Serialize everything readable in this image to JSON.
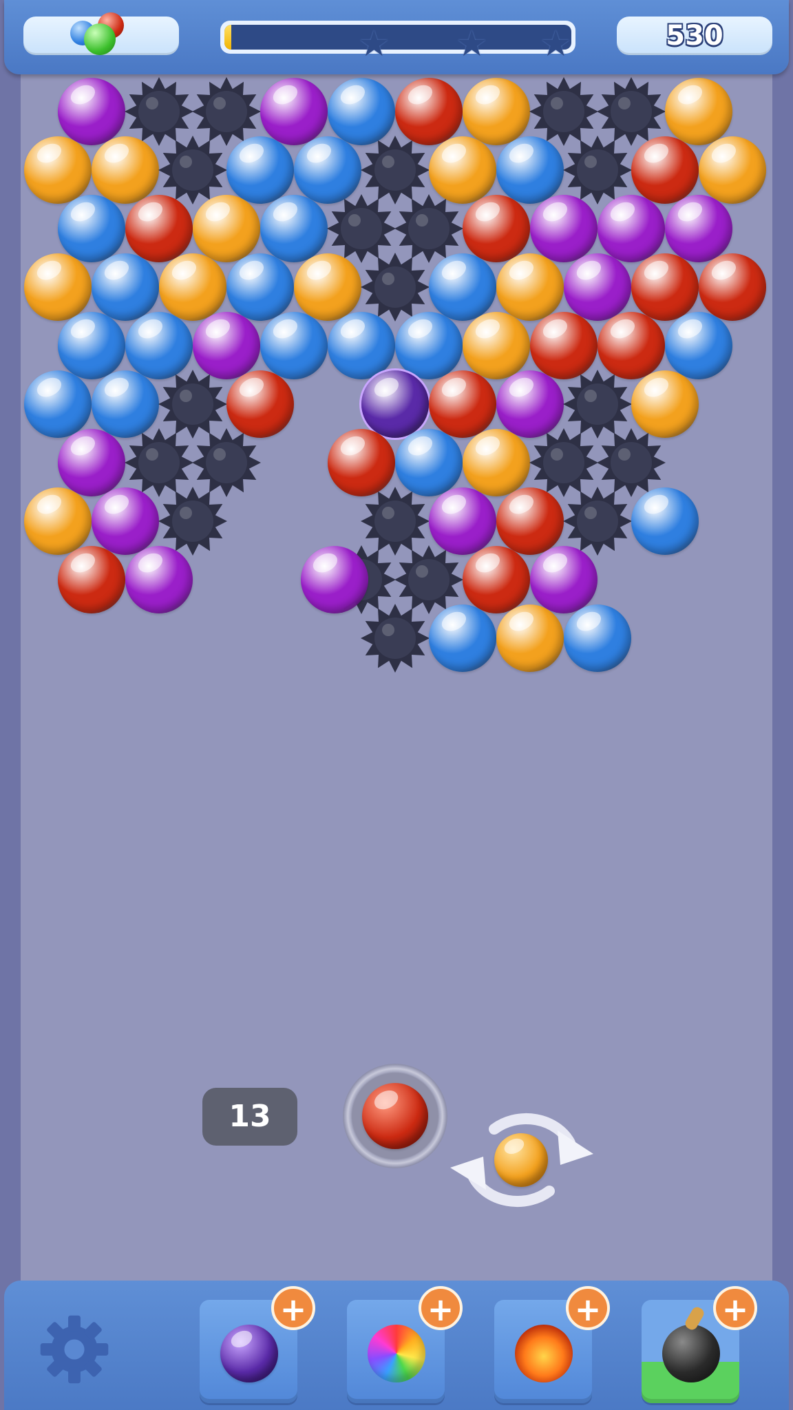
{
  "hud": {
    "score": "530",
    "progress": 0.02,
    "stars": [
      "star-1",
      "star-2",
      "star-3"
    ],
    "bubble_colors": [
      "blue",
      "red",
      "green"
    ]
  },
  "shooter": {
    "moves_left": "13",
    "current_bubble": "red",
    "next_bubble": "orange"
  },
  "boosters": [
    {
      "name": "lightning-bubble",
      "plus": "+"
    },
    {
      "name": "rainbow-bubble",
      "plus": "+"
    },
    {
      "name": "fire-bubble",
      "plus": "+"
    },
    {
      "name": "bomb",
      "plus": "+"
    }
  ],
  "colors": {
    "blue": "#2f7fe0",
    "red": "#cc2a12",
    "orange": "#f3a11e",
    "purple": "#9a1fc9",
    "green": "#3cbf2c",
    "spike": "#2e3045",
    "lightning": "#5a2aa8"
  },
  "board": {
    "grid_rows": [
      [
        "P",
        "S",
        "S",
        "P",
        "B",
        "R",
        "O",
        "S",
        "S",
        "O"
      ],
      [
        "O",
        "O",
        "S",
        "B",
        "B",
        "S",
        "O",
        "B",
        "S",
        "R",
        "O"
      ],
      [
        "B",
        "R",
        "O",
        "B",
        "S",
        "S",
        "R",
        "P",
        "P",
        "P"
      ],
      [
        "O",
        "B",
        "O",
        "B",
        "O",
        "S",
        "B",
        "O",
        "P",
        "R",
        "R"
      ],
      [
        "B",
        "B",
        "P",
        "B",
        "B",
        "B",
        "O",
        "R",
        "R",
        "B"
      ],
      [
        "B",
        "B",
        "S",
        "R",
        "",
        "L",
        "R",
        "P",
        "S",
        "O"
      ],
      [
        "P",
        "S",
        "S",
        "",
        "R",
        "B",
        "O",
        "S",
        "S"
      ],
      [
        "O",
        "P",
        "S",
        "",
        "",
        "S",
        "P",
        "R",
        "S",
        "B"
      ],
      [
        "R",
        "P",
        "",
        "",
        "S",
        "S",
        "R",
        "P"
      ],
      [
        "",
        "",
        "",
        "",
        "",
        "S",
        "B",
        "O",
        "B"
      ]
    ],
    "extra": [
      {
        "row": 8,
        "col": 3.6,
        "color": "P"
      }
    ]
  }
}
